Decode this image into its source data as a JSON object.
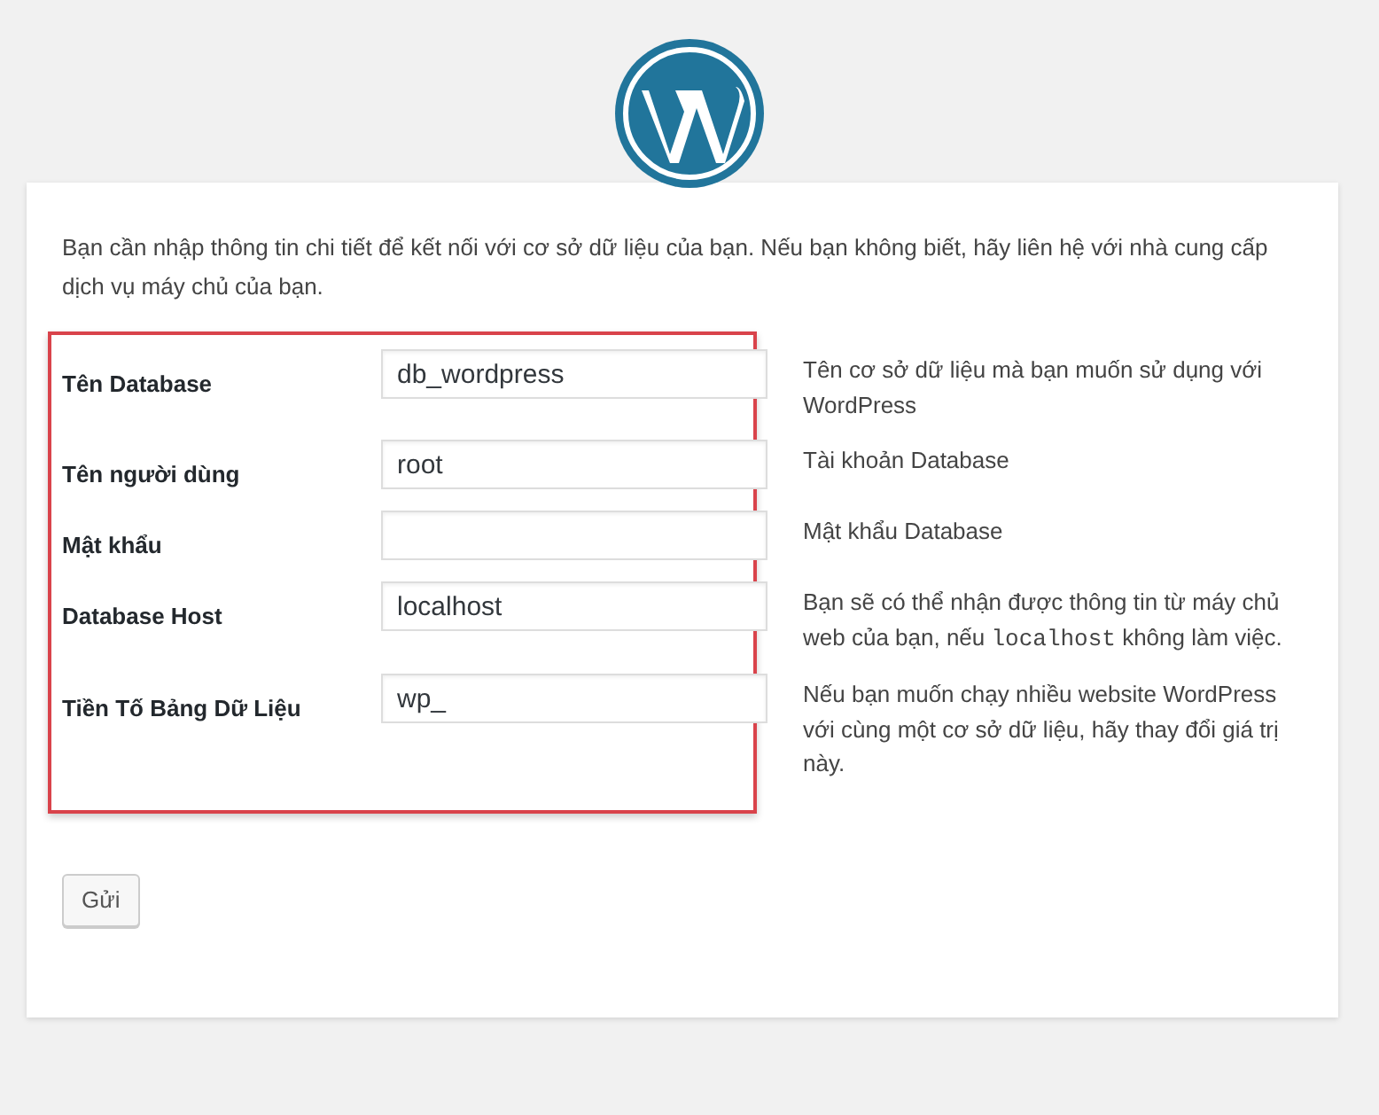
{
  "intro": "Bạn cần nhập thông tin chi tiết để kết nối với cơ sở dữ liệu của bạn. Nếu bạn không biết, hãy liên hệ với nhà cung cấp dịch vụ máy chủ của bạn.",
  "fields": [
    {
      "label": "Tên Database",
      "value": "db_wordpress",
      "hint": [
        {
          "kind": "text",
          "text": "Tên cơ sở dữ liệu mà bạn muốn sử dụng với WordPress"
        }
      ]
    },
    {
      "label": "Tên người dùng",
      "value": "root",
      "hint": [
        {
          "kind": "text",
          "text": "Tài khoản Database"
        }
      ]
    },
    {
      "label": "Mật khẩu",
      "hint": [
        {
          "kind": "text",
          "text": "Mật khẩu Database"
        }
      ]
    },
    {
      "label": "Database Host",
      "value": "localhost",
      "hint": [
        {
          "kind": "text",
          "text": "Bạn sẽ có thể nhận được thông tin từ máy chủ web của bạn, nếu "
        },
        {
          "kind": "code",
          "text": "localhost"
        },
        {
          "kind": "text",
          "text": " không làm việc."
        }
      ]
    },
    {
      "label": "Tiền Tố Bảng Dữ Liệu",
      "value": "wp_",
      "hint": [
        {
          "kind": "text",
          "text": "Nếu bạn muốn chạy nhiều website WordPress với cùng một cơ sở dữ liệu, hãy thay đổi giá trị này."
        }
      ]
    }
  ],
  "submit": "Gửi"
}
